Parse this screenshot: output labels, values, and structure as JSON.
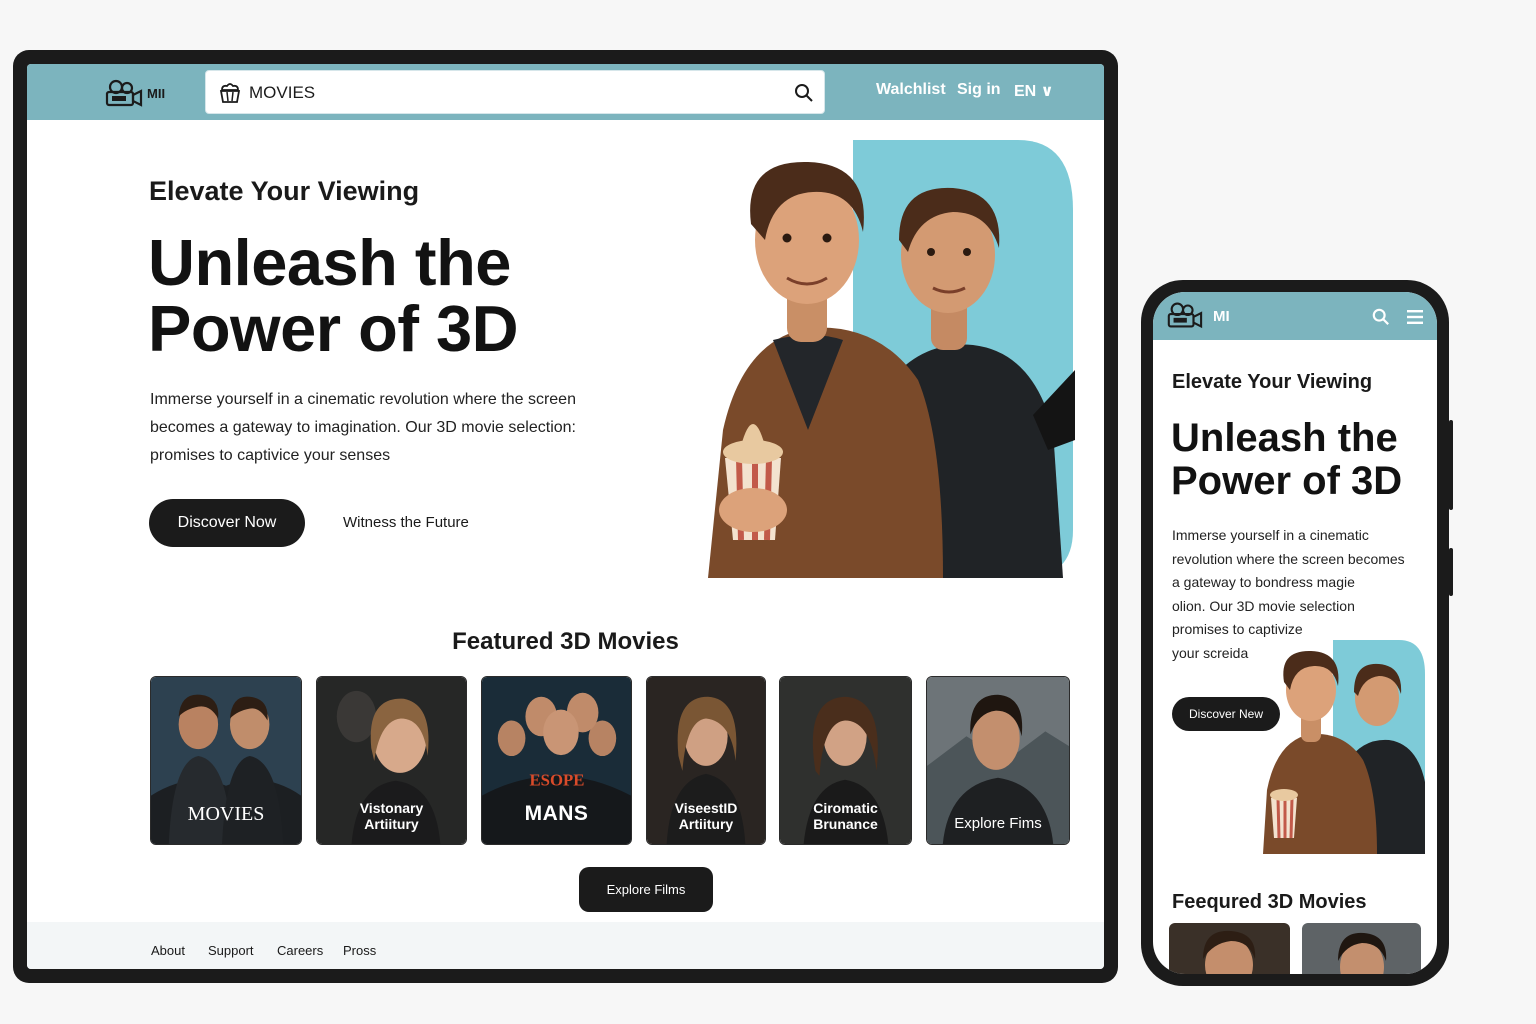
{
  "desktop": {
    "nav": {
      "logo_text": "MII",
      "search_text": "MOVIES",
      "links": [
        "Walchlist",
        "Sig in",
        "EN ∨"
      ]
    },
    "hero": {
      "kicker": "Elevate Your Viewing",
      "headline_line1": "Unleash the",
      "headline_line2": "Power of 3D",
      "body_line1": "Immerse yourself in a cinematic revolution where the screen",
      "body_line2": "becomes a gateway to imagination. Our 3D movie selection:",
      "body_line3": "promises to captivice your senses",
      "primary_cta": "Discover Now",
      "secondary_link": "Witness the Future"
    },
    "featured": {
      "title": "Featured 3D Movies",
      "cards": [
        {
          "title": "MOVIES"
        },
        {
          "title_line1": "Vistonary",
          "title_line2": "Artiitury"
        },
        {
          "tag": "ESOPE",
          "title": "MANS"
        },
        {
          "title_line1": "ViseestID",
          "title_line2": "Artiitury"
        },
        {
          "title_line1": "Ciromatic",
          "title_line2": "Brunance"
        },
        {
          "title": "Explore Fims"
        }
      ],
      "explore_button": "Explore Films"
    },
    "footer": {
      "links": [
        "About",
        "Support",
        "Careers",
        "Pross"
      ]
    }
  },
  "mobile": {
    "nav": {
      "logo_text": "MI"
    },
    "hero": {
      "kicker": "Elevate Your Viewing",
      "headline_line1": "Unleash the",
      "headline_line2": "Power of 3D",
      "body_lines": [
        "Immerse yourself in a cinematic",
        "revolution where the screen becomes",
        "a gateway to bondress magie",
        "olion. Our 3D movie selection",
        "promises to captivize",
        "your screida"
      ],
      "primary_cta": "Discover New"
    },
    "featured_title": "Feequred 3D Movies"
  },
  "colors": {
    "nav_bg": "#7cb4be",
    "accent_panel": "#7ecbd8",
    "button_dark": "#1b1b1b",
    "frame": "#1b1b1b"
  }
}
